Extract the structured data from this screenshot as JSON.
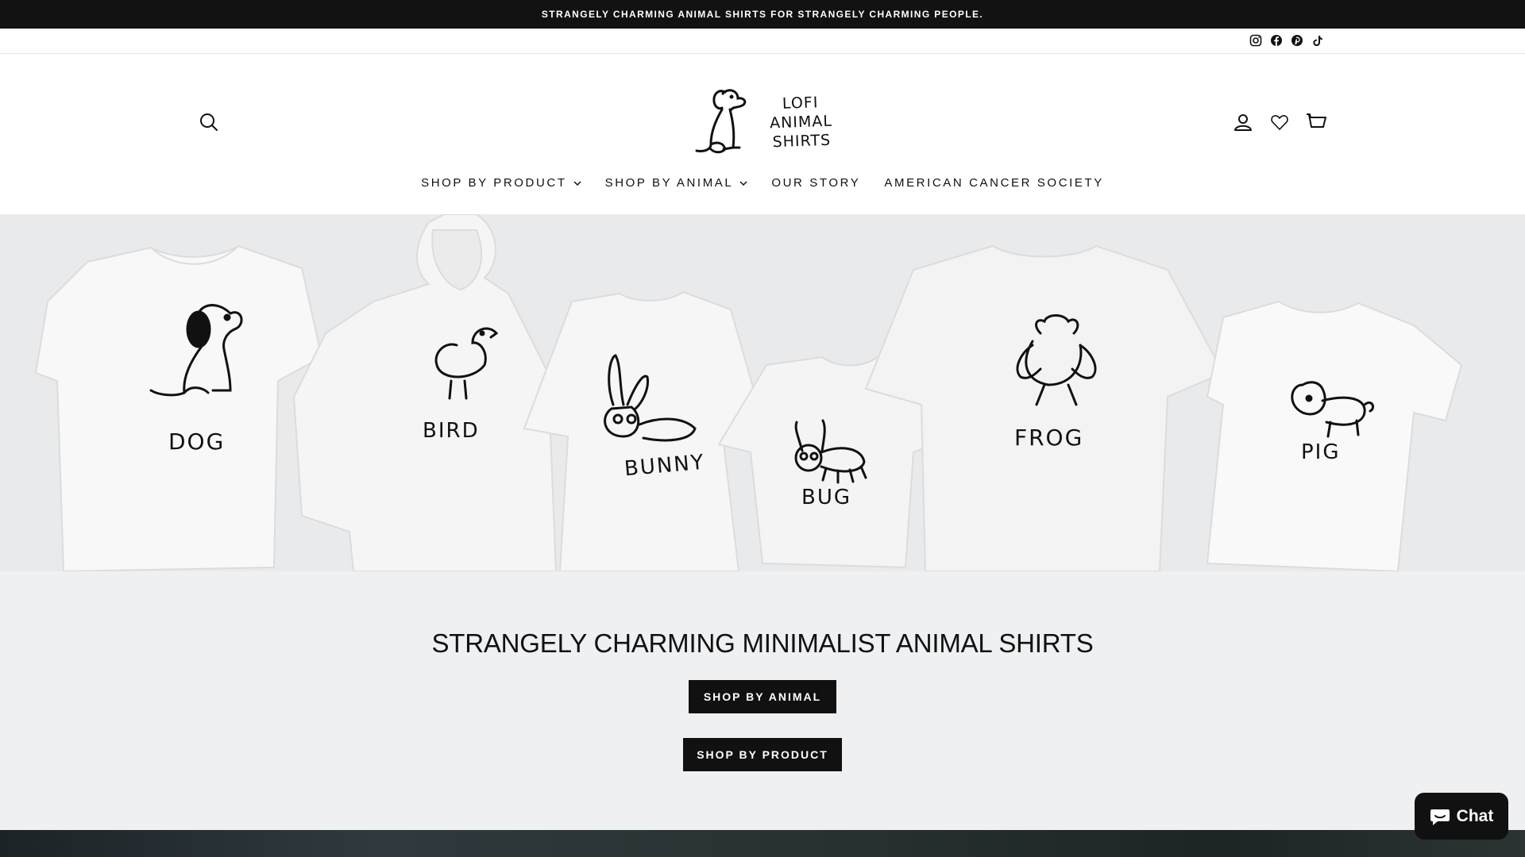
{
  "announcement": "STRANGELY CHARMING ANIMAL SHIRTS FOR STRANGELY CHARMING PEOPLE.",
  "social": [
    "instagram-icon",
    "facebook-icon",
    "pinterest-icon",
    "tiktok-icon"
  ],
  "logo": {
    "line1": "LOFI",
    "line2": "ANIMAL",
    "line3": "SHIRTS"
  },
  "header_icons": [
    "search-icon",
    "account-icon",
    "heart-icon",
    "cart-icon"
  ],
  "nav": [
    {
      "label": "SHOP BY PRODUCT",
      "dropdown": true
    },
    {
      "label": "SHOP BY ANIMAL",
      "dropdown": true
    },
    {
      "label": "OUR STORY",
      "dropdown": false
    },
    {
      "label": "AMERICAN CANCER SOCIETY",
      "dropdown": false
    }
  ],
  "hero": {
    "shirts": [
      "DOG",
      "BIRD",
      "BUNNY",
      "BUG",
      "FROG",
      "PIG"
    ]
  },
  "promo": {
    "heading": "STRANGELY CHARMING MINIMALIST ANIMAL SHIRTS",
    "button_animal": "SHOP BY ANIMAL",
    "button_product": "SHOP BY PRODUCT"
  },
  "chat": {
    "label": "Chat"
  },
  "colors": {
    "dark": "#111111",
    "hero_bg": "#e9eaec",
    "promo_bg": "#eff0f2"
  }
}
